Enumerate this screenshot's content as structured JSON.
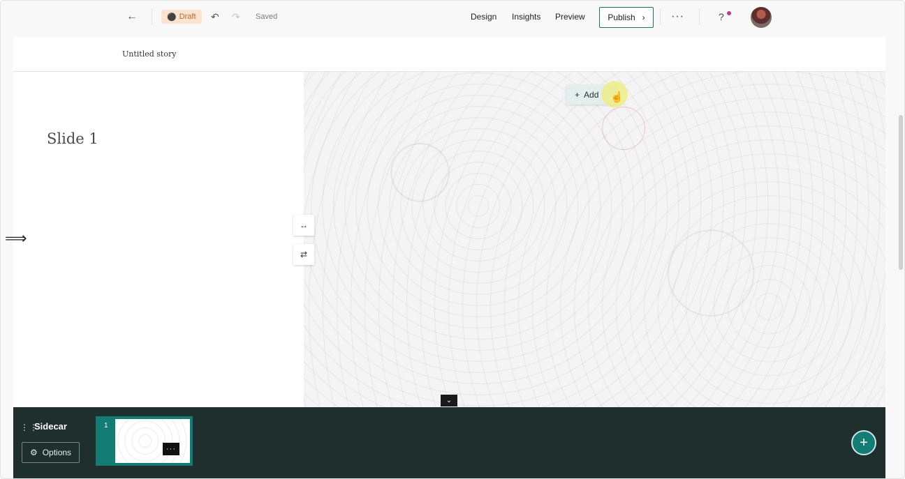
{
  "topbar": {
    "back_icon": "←",
    "draft_label": "Draft",
    "undo_icon": "↶",
    "redo_icon": "↷",
    "saved_label": "Saved",
    "nav": [
      {
        "label": "Design"
      },
      {
        "label": "Insights"
      },
      {
        "label": "Preview"
      }
    ],
    "publish_label": "Publish",
    "more_icon": "···",
    "help_icon": "?"
  },
  "story": {
    "title": "Untitled story"
  },
  "slide": {
    "title": "Slide 1"
  },
  "media": {
    "add_label": "Add"
  },
  "dock": {
    "title": "Sidecar",
    "options_label": "Options",
    "thumb_number": "1",
    "thumb_more": "···",
    "add_icon": "+"
  },
  "colors": {
    "accent": "#137c75",
    "dock_bg": "#1e2f2e",
    "draft_bg": "#fbe3cf"
  }
}
